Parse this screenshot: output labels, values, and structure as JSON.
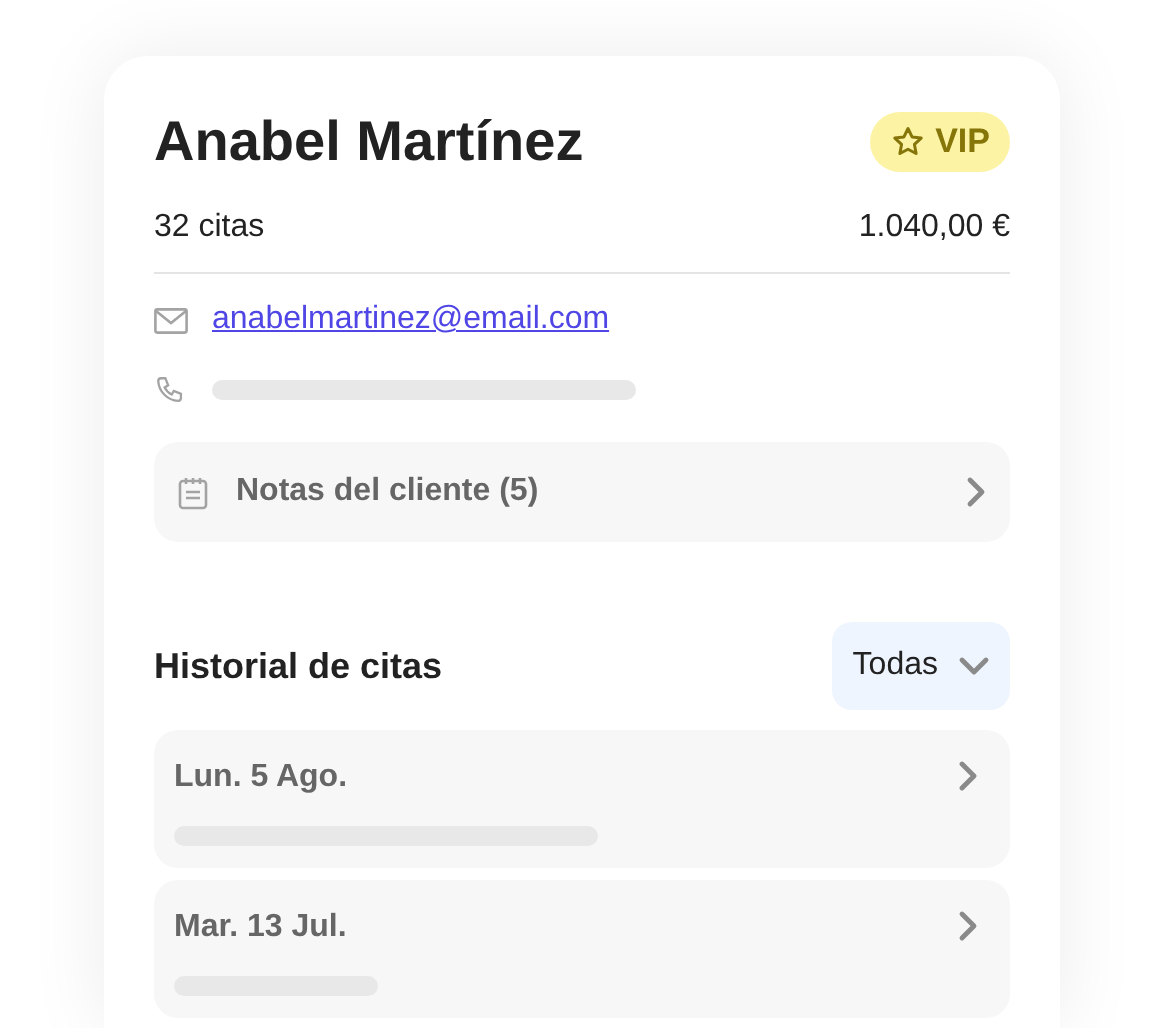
{
  "client": {
    "name": "Anabel Martínez",
    "badge": "VIP",
    "appointments_count": "32 citas",
    "total": "1.040,00 €",
    "email": "anabelmartinez@email.com"
  },
  "notes_button": {
    "label": "Notas del cliente (5)"
  },
  "history": {
    "title": "Historial de citas",
    "filter": "Todas",
    "appointments": [
      {
        "date": "Lun. 5 Ago."
      },
      {
        "date": "Mar. 13 Jul."
      }
    ]
  }
}
